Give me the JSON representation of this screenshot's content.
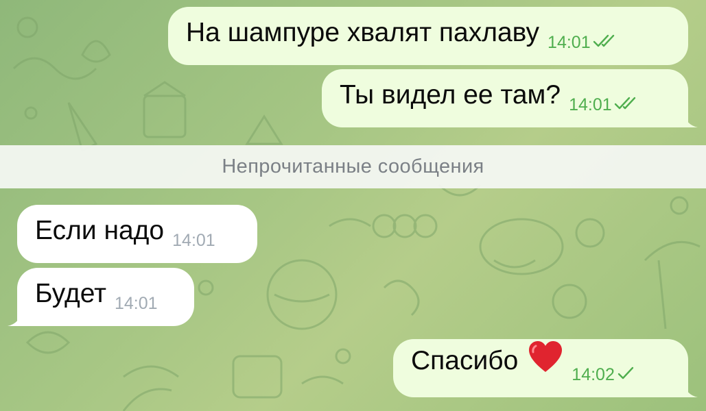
{
  "messages_before": [
    {
      "id": "m1",
      "text": "На шампуре хвалят пахлаву",
      "time": "14:01",
      "status": "read"
    },
    {
      "id": "m2",
      "text": "Ты видел ее там?",
      "time": "14:01",
      "status": "read"
    }
  ],
  "unread_divider": "Непрочитанные сообщения",
  "messages_after": [
    {
      "id": "m3",
      "text": "Если надо",
      "time": "14:01"
    },
    {
      "id": "m4",
      "text": "Будет",
      "time": "14:01"
    },
    {
      "id": "m5",
      "text": "Спасибо",
      "emoji": "heart",
      "time": "14:02",
      "status": "sent"
    }
  ],
  "colors": {
    "outgoing_bubble": "#effdde",
    "incoming_bubble": "#ffffff",
    "outgoing_meta": "#4fae4e",
    "incoming_meta": "#a1aab3",
    "wallpaper": "#a6c684",
    "heart": "#e0242f"
  },
  "icons": [
    "double-check-icon",
    "single-check-icon",
    "red-heart-icon"
  ]
}
